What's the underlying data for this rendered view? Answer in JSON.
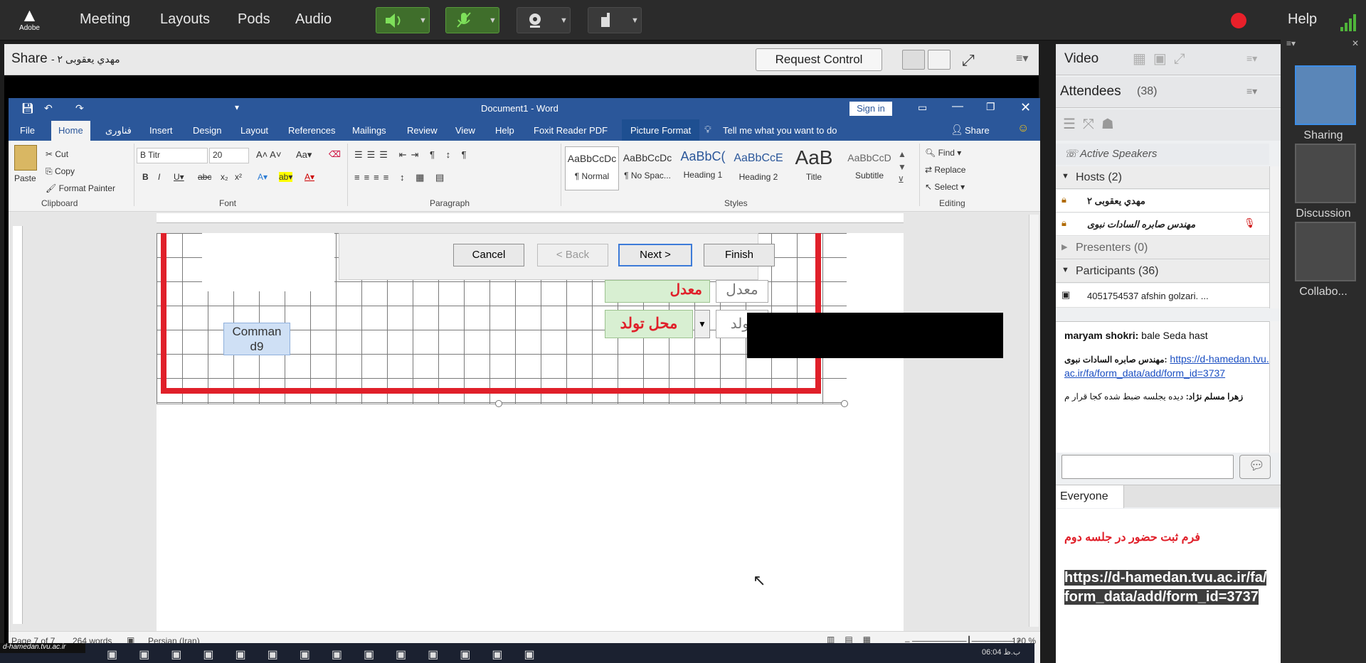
{
  "topbar": {
    "logo_text": "Adobe",
    "menus": [
      "Meeting",
      "Layouts",
      "Pods",
      "Audio"
    ],
    "help": "Help",
    "colors": {
      "bg": "#2b2b2b",
      "mic_active": "#3f6e2b",
      "record": "#e8202a"
    }
  },
  "share": {
    "title": "Share",
    "presenter": "مهدي  يعقوبی ٢",
    "request_control": "Request Control"
  },
  "word": {
    "title": "Document1  -  Word",
    "sign_in": "Sign in",
    "tabs": [
      "File",
      "Home",
      "فناوری",
      "Insert",
      "Design",
      "Layout",
      "References",
      "Mailings",
      "Review",
      "View",
      "Help",
      "Foxit Reader PDF",
      "Picture Format"
    ],
    "tell_me": "Tell me what you want to do",
    "share": "Share",
    "clipboard": {
      "paste": "Paste",
      "cut": "Cut",
      "copy": "Copy",
      "format_painter": "Format Painter",
      "label": "Clipboard"
    },
    "font": {
      "name": "B Titr",
      "size": "20",
      "label": "Font"
    },
    "paragraph_label": "Paragraph",
    "styles": [
      {
        "sample": "AaBbCcDc",
        "name": "¶ Normal"
      },
      {
        "sample": "AaBbCcDc",
        "name": "¶ No Spac..."
      },
      {
        "sample": "AaBbC(",
        "name": "Heading 1"
      },
      {
        "sample": "AaBbCcE",
        "name": "Heading 2"
      },
      {
        "sample": "AaB",
        "name": "Title"
      },
      {
        "sample": "AaBbCcD",
        "name": "Subtitle"
      }
    ],
    "styles_label": "Styles",
    "editing": {
      "find": "Find",
      "replace": "Replace",
      "select": "Select",
      "label": "Editing"
    },
    "wizard": {
      "cancel": "Cancel",
      "back": "< Back",
      "next": "Next >",
      "finish": "Finish"
    },
    "form": {
      "field1": "معدل",
      "field2": "محل تولد",
      "label1": "معدل",
      "label2": "تولد",
      "command": "Comman d9"
    },
    "status": {
      "page": "Page 7 of 7",
      "words": "264 words",
      "language": "Persian (Iran)",
      "zoom": "120 %"
    }
  },
  "taskbar": {
    "site": "d-hamedan.tvu.ac.ir",
    "time": "06:04 ب.ظ"
  },
  "video": {
    "title": "Video"
  },
  "attendees": {
    "title": "Attendees",
    "count": "(38)",
    "active_speakers": "Active Speakers",
    "hosts_label": "Hosts (2)",
    "hosts": [
      "مهدي  يعقوبی ٢",
      "مهندس صابره السادات نبوی"
    ],
    "presenters_label": "Presenters (0)",
    "participants_label": "Participants (36)",
    "participants": [
      "4051754537 afshin golzari.  ..."
    ]
  },
  "chat": {
    "messages": [
      {
        "sender": "maryam shokri:",
        "text": "bale Seda hast"
      },
      {
        "sender": "مهندس صابره السادات نبوی:",
        "text": "https://d-hamedan.tvu.ac.ir/fa/form_data/add/form_id=3737"
      },
      {
        "sender": "زهرا مسلم نژاد:",
        "text": "دیده یجلسه ضبط شده کجا قرار م"
      }
    ],
    "audience": "Everyone"
  },
  "notes": {
    "heading": "فرم ثبت حضور در جلسه دوم",
    "link": "https://d-hamedan.tvu.ac.ir/fa/form_data/add/form_id=3737"
  },
  "layouts": [
    "Sharing",
    "Discussion",
    "Collabo..."
  ]
}
